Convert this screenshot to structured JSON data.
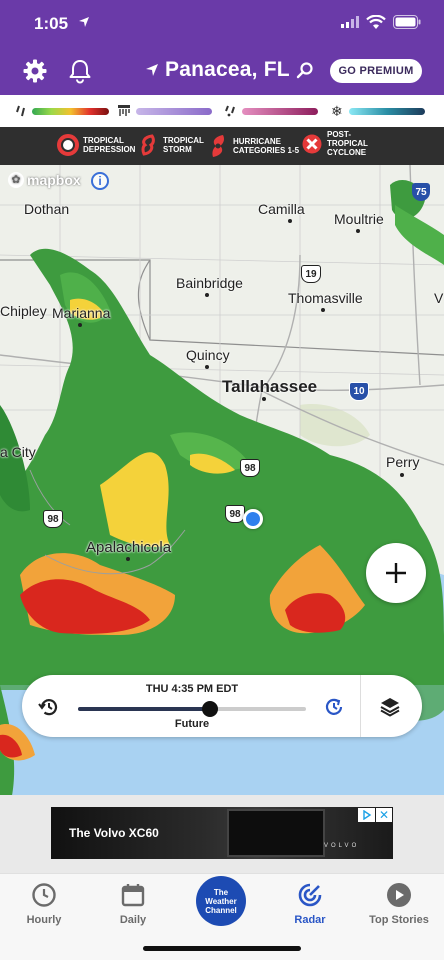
{
  "status": {
    "time": "1:05"
  },
  "header": {
    "location": "Panacea, FL",
    "premium_label": "GO PREMIUM"
  },
  "legend": {
    "items": [
      {
        "name": "rain",
        "icon": "rain-drops-icon",
        "gradient": [
          "#33a852",
          "#f2c12e",
          "#e2322d",
          "#7a0f0f"
        ]
      },
      {
        "name": "mix",
        "icon": "mix-icon",
        "gradient": [
          "#b19cd9",
          "#8a6ac9"
        ]
      },
      {
        "name": "sleet",
        "icon": "sleet-icon",
        "gradient": [
          "#d96aa8",
          "#8d1d5c"
        ]
      },
      {
        "name": "snow",
        "icon": "snowflake-icon",
        "gradient": [
          "#7ee3f0",
          "#1d3b5a"
        ]
      }
    ]
  },
  "tropical": {
    "items": [
      {
        "label1": "TROPICAL",
        "label2": "DEPRESSION",
        "icon": "tropical-depression-icon"
      },
      {
        "label1": "TROPICAL",
        "label2": "STORM",
        "icon": "tropical-storm-icon"
      },
      {
        "label1": "HURRICANE",
        "label2": "CATEGORIES 1-5",
        "icon": "hurricane-icon"
      },
      {
        "label1": "POST-",
        "label2": "TROPICAL",
        "label3": "CYCLONE",
        "icon": "post-tropical-icon"
      }
    ]
  },
  "map": {
    "attribution": "mapbox",
    "cities": {
      "dothan": "Dothan",
      "camilla": "Camilla",
      "moultrie": "Moultrie",
      "bainbridge": "Bainbridge",
      "thomasville": "Thomasville",
      "chipley": "Chipley",
      "marianna": "Marianna",
      "quincy": "Quincy",
      "tallahassee": "Tallahassee",
      "city_partial": "a City",
      "perry": "Perry",
      "apalachicola": "Apalachicola",
      "valdosta_partial": "V"
    },
    "shields": {
      "i75": "75",
      "us19": "19",
      "i10": "10",
      "us98_a": "98",
      "us98_b": "98",
      "us98_c": "98"
    }
  },
  "timeline": {
    "time_label": "THU 4:35 PM EDT",
    "mode_label": "Future",
    "progress": 0.58
  },
  "ad": {
    "title": "The Volvo XC60",
    "brand": "VOLVO"
  },
  "nav": {
    "items": [
      {
        "label": "Hourly",
        "icon": "clock-icon"
      },
      {
        "label": "Daily",
        "icon": "calendar-icon"
      },
      {
        "label": "The Weather Channel",
        "icon": "twc-logo"
      },
      {
        "label": "Radar",
        "icon": "radar-icon"
      },
      {
        "label": "Top Stories",
        "icon": "play-icon"
      }
    ],
    "active": "Radar",
    "logo_text": "The Weather Channel"
  }
}
